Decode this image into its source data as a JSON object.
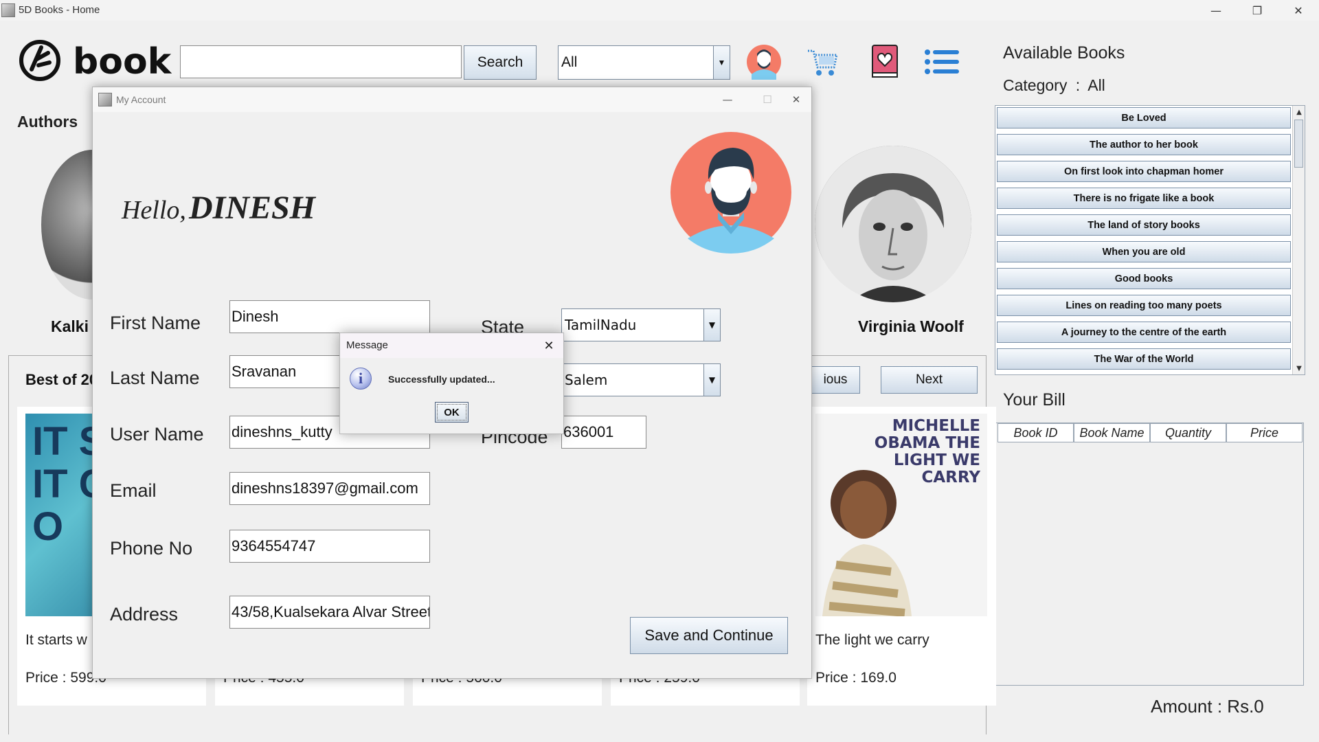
{
  "window": {
    "title": "5D Books - Home",
    "minimize": "—",
    "maximize": "❐",
    "close": "✕"
  },
  "toolbar": {
    "logo_text": "book",
    "search_value": "",
    "search_button": "Search",
    "category_selected": "All",
    "icons": [
      "profile-avatar-icon",
      "cart-icon",
      "favourite-book-icon",
      "menu-list-icon"
    ]
  },
  "right_panel": {
    "available_title": "Available Books",
    "category_label": "Category",
    "category_sep": ":",
    "category_value": "All",
    "books": [
      "Be Loved",
      "The author to her book",
      "On first look into chapman homer",
      "There is no frigate like a book",
      "The land of story books",
      "When you are old",
      "Good books",
      "Lines on reading too many poets",
      "A journey to the centre of the earth",
      "The War of the World"
    ],
    "bill_title": "Your Bill",
    "bill_columns": [
      "Book ID",
      "Book Name",
      "Quantity",
      "Price"
    ],
    "amount_label": "Amount :",
    "amount_value": "Rs.0"
  },
  "background": {
    "authors_title": "Authors",
    "authors": [
      "Kalki",
      "Virginia Woolf"
    ],
    "best_title": "Best of 20",
    "prev_button": "ious",
    "next_button": "Next",
    "cards": [
      {
        "name": "It starts w",
        "price": "Price : 599.0",
        "cover_text": "IT STA WIT CO HO"
      },
      {
        "name": "",
        "price": "Price : 455.0"
      },
      {
        "name": "",
        "price": "Price : 560.0"
      },
      {
        "name": "",
        "price": "Price : 259.0"
      },
      {
        "name": "The light we carry",
        "price": "Price : 169.0",
        "cover_text": "MICHELLE OBAMA THE LIGHT WE CARRY"
      }
    ]
  },
  "account_dialog": {
    "title": "My Account",
    "minimize": "—",
    "maximize": "☐",
    "close": "✕",
    "greeting": "Hello,",
    "username_display": "DINESH",
    "labels": {
      "first_name": "First Name",
      "last_name": "Last Name",
      "user_name": "User Name",
      "email": "Email",
      "phone": "Phone No",
      "address": "Address",
      "state": "State",
      "pincode": "Pincode"
    },
    "values": {
      "first_name": "Dinesh",
      "last_name": "Sravanan",
      "user_name": "dineshns_kutty",
      "email": "dineshns18397@gmail.com",
      "phone": "9364554747",
      "address": "43/58,Kualsekara Alvar Street",
      "state": "TamilNadu",
      "city": "Salem",
      "pincode": "636001"
    },
    "save_button": "Save and Continue"
  },
  "message_dialog": {
    "title": "Message",
    "close": "✕",
    "icon_glyph": "i",
    "text": "Successfully updated...",
    "ok": "OK"
  },
  "colors": {
    "avatar_bg": "#F47B67",
    "avatar_shirt": "#7CCCF0",
    "button_gradient_top": "#F7FAFD",
    "button_gradient_bottom": "#CFDBE8"
  }
}
